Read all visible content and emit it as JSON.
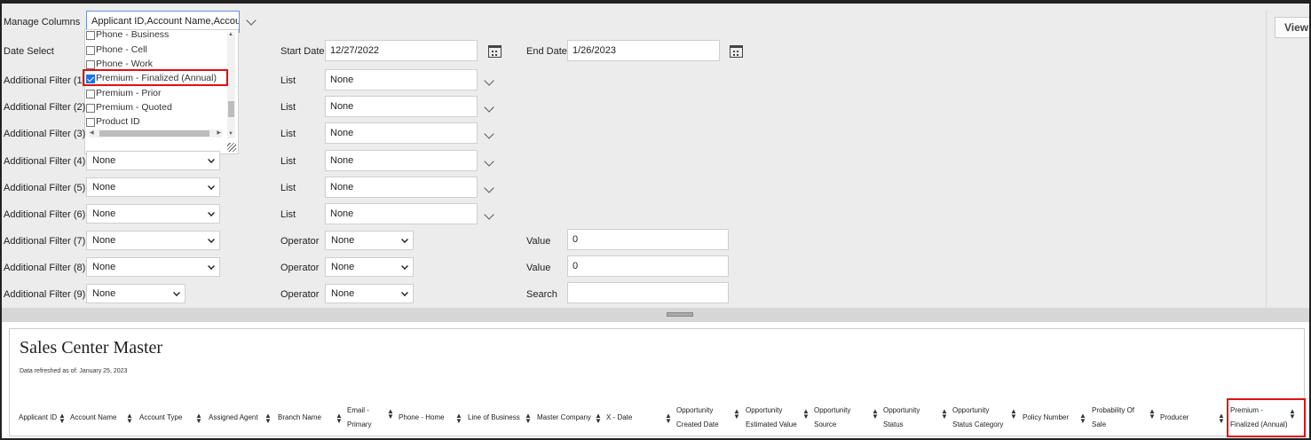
{
  "manage_columns": {
    "label": "Manage Columns",
    "value": "Applicant ID,Account Name,Accou"
  },
  "dropdown_options": [
    {
      "label": "Phone - Business",
      "checked": false
    },
    {
      "label": "Phone - Cell",
      "checked": false
    },
    {
      "label": "Phone - Work",
      "checked": false
    },
    {
      "label": "Premium - Finalized (Annual)",
      "checked": true
    },
    {
      "label": "Premium - Prior",
      "checked": false
    },
    {
      "label": "Premium - Quoted",
      "checked": false
    },
    {
      "label": "Product ID",
      "checked": false
    }
  ],
  "date_select": {
    "label": "Date Select",
    "start_label": "Start Date",
    "start_value": "12/27/2022",
    "end_label": "End Date",
    "end_value": "1/26/2023"
  },
  "view_button": "View",
  "filters": [
    {
      "label": "Additional Filter (1",
      "value": "",
      "mid_label": "List",
      "mid_value": "None"
    },
    {
      "label": "Additional Filter (2)",
      "value": "",
      "mid_label": "List",
      "mid_value": "None"
    },
    {
      "label": "Additional Filter (3)",
      "value": "",
      "mid_label": "List",
      "mid_value": "None"
    },
    {
      "label": "Additional Filter (4)",
      "value": "None",
      "mid_label": "List",
      "mid_value": "None"
    },
    {
      "label": "Additional Filter (5)",
      "value": "None",
      "mid_label": "List",
      "mid_value": "None"
    },
    {
      "label": "Additional Filter (6)",
      "value": "None",
      "mid_label": "List",
      "mid_value": "None"
    },
    {
      "label": "Additional Filter (7)",
      "value": "None",
      "mid_label": "Operator",
      "mid_value": "None",
      "right_label": "Value",
      "right_value": "0"
    },
    {
      "label": "Additional Filter (8)",
      "value": "None",
      "mid_label": "Operator",
      "mid_value": "None",
      "right_label": "Value",
      "right_value": "0"
    },
    {
      "label": "Additional Filter (9)",
      "value": "None",
      "mid_label": "Operator",
      "mid_value": "None",
      "right_label": "Search",
      "right_value": ""
    }
  ],
  "report": {
    "title": "Sales Center Master",
    "refreshed": "Data refreshed as of: January 25, 2023",
    "columns": [
      {
        "l1": "Applicant ID",
        "l2": ""
      },
      {
        "l1": "Account Name",
        "l2": ""
      },
      {
        "l1": "Account Type",
        "l2": ""
      },
      {
        "l1": "Assigned Agent",
        "l2": ""
      },
      {
        "l1": "Branch Name",
        "l2": ""
      },
      {
        "l1": "Email -",
        "l2": "Primary"
      },
      {
        "l1": "Phone - Home",
        "l2": ""
      },
      {
        "l1": "Line of Business",
        "l2": ""
      },
      {
        "l1": "Master Company",
        "l2": ""
      },
      {
        "l1": "X - Date",
        "l2": ""
      },
      {
        "l1": "Opportunity",
        "l2": "Created Date"
      },
      {
        "l1": "Opportunity",
        "l2": "Estimated Value"
      },
      {
        "l1": "Opportunity",
        "l2": "Source"
      },
      {
        "l1": "Opportunity",
        "l2": "Status"
      },
      {
        "l1": "Opportunity",
        "l2": "Status Category"
      },
      {
        "l1": "Policy Number",
        "l2": ""
      },
      {
        "l1": "Probability Of",
        "l2": "Sale"
      },
      {
        "l1": "Producer",
        "l2": ""
      },
      {
        "l1": "Premium -",
        "l2": "Finalized (Annual)"
      }
    ]
  }
}
